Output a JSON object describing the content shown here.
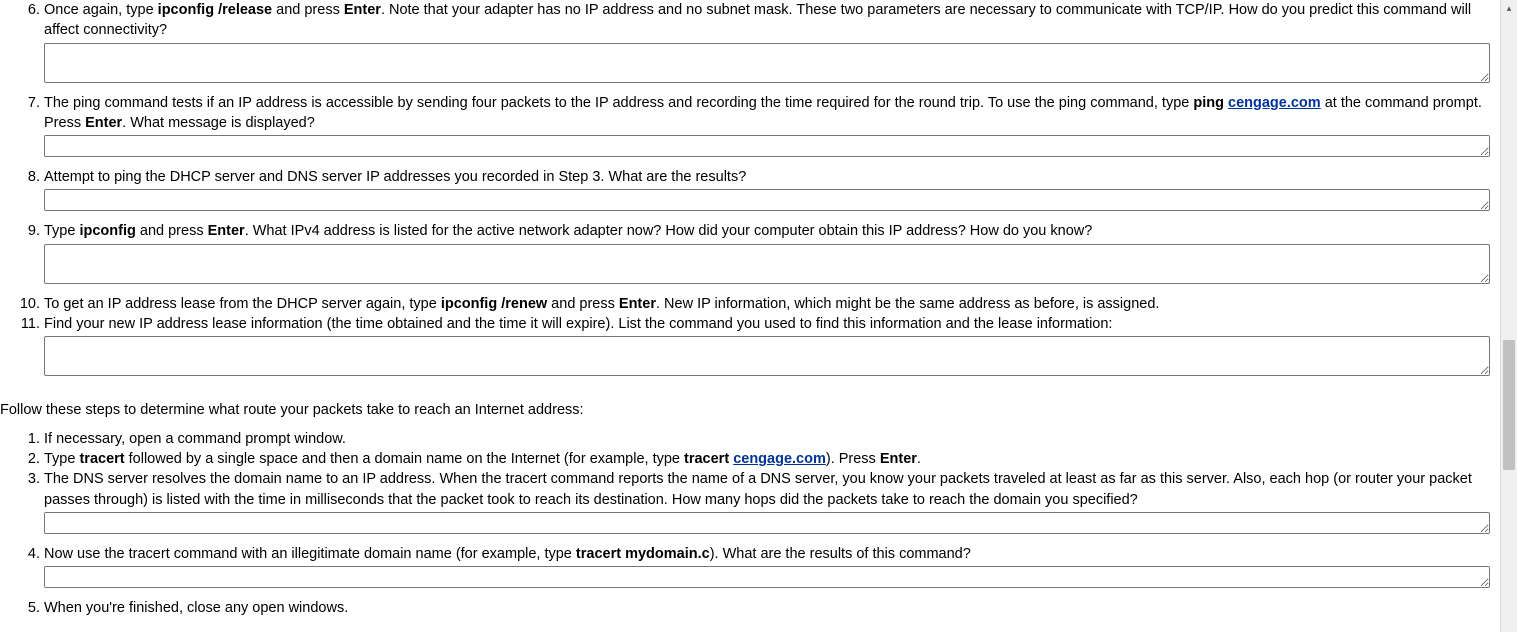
{
  "list1": {
    "start": 6,
    "items": [
      {
        "segments": [
          {
            "text": "Once again, type "
          },
          {
            "text": "ipconfig /release",
            "bold": true
          },
          {
            "text": " and press "
          },
          {
            "text": "Enter",
            "bold": true
          },
          {
            "text": ". Note that your adapter has no IP address and no subnet mask. These two parameters are necessary to communicate with TCP/IP. How do you predict this command will affect connectivity?"
          }
        ],
        "textarea": "multi"
      },
      {
        "segments": [
          {
            "text": "The ping command tests if an IP address is accessible by sending four packets to the IP address and recording the time required for the round trip. To use the ping command, type "
          },
          {
            "text": "ping ",
            "bold": true
          },
          {
            "text": "cengage.com",
            "bold": true,
            "link": true
          },
          {
            "text": " at the command prompt. Press "
          },
          {
            "text": "Enter",
            "bold": true
          },
          {
            "text": ". What message is displayed?"
          }
        ],
        "textarea": "single"
      },
      {
        "segments": [
          {
            "text": "Attempt to ping the DHCP server and DNS server IP addresses you recorded in Step 3. What are the results?"
          }
        ],
        "textarea": "single"
      },
      {
        "segments": [
          {
            "text": "Type "
          },
          {
            "text": "ipconfig",
            "bold": true
          },
          {
            "text": " and press "
          },
          {
            "text": "Enter",
            "bold": true
          },
          {
            "text": ". What IPv4 address is listed for the active network adapter now? How did your computer obtain this IP address? How do you know?"
          }
        ],
        "textarea": "multi"
      },
      {
        "segments": [
          {
            "text": "To get an IP address lease from the DHCP server again, type "
          },
          {
            "text": "ipconfig /renew",
            "bold": true
          },
          {
            "text": " and press "
          },
          {
            "text": "Enter",
            "bold": true
          },
          {
            "text": ". New IP information, which might be the same address as before, is assigned."
          }
        ],
        "textarea": null,
        "tight": true
      },
      {
        "segments": [
          {
            "text": "Find your new IP address lease information (the time obtained and the time it will expire). List the command you used to find this information and the lease information:"
          }
        ],
        "textarea": "multi"
      }
    ]
  },
  "intro": "Follow these steps to determine what route your packets take to reach an Internet address:",
  "list2": {
    "start": 1,
    "items": [
      {
        "segments": [
          {
            "text": "If necessary, open a command prompt window."
          }
        ],
        "textarea": null,
        "tight": true
      },
      {
        "segments": [
          {
            "text": "Type "
          },
          {
            "text": "tracert",
            "bold": true
          },
          {
            "text": " followed by a single space and then a domain name on the Internet (for example, type "
          },
          {
            "text": "tracert ",
            "bold": true
          },
          {
            "text": "cengage.com",
            "bold": true,
            "link": true
          },
          {
            "text": "). Press "
          },
          {
            "text": "Enter",
            "bold": true
          },
          {
            "text": "."
          }
        ],
        "textarea": null,
        "tight": true
      },
      {
        "segments": [
          {
            "text": "The DNS server resolves the domain name to an IP address. When the tracert command reports the name of a DNS server, you know your packets traveled at least as far as this server. Also, each hop (or router your packet passes through) is listed with the time in milliseconds that the packet took to reach its destination. How many hops did the packets take to reach the domain you specified?"
          }
        ],
        "textarea": "single"
      },
      {
        "segments": [
          {
            "text": "Now use the tracert command with an illegitimate domain name (for example, type "
          },
          {
            "text": "tracert mydomain.c",
            "bold": true
          },
          {
            "text": "). What are the results of this command?"
          }
        ],
        "textarea": "single"
      },
      {
        "segments": [
          {
            "text": "When you're finished, close any open windows."
          }
        ],
        "textarea": null,
        "tight": true
      }
    ]
  }
}
